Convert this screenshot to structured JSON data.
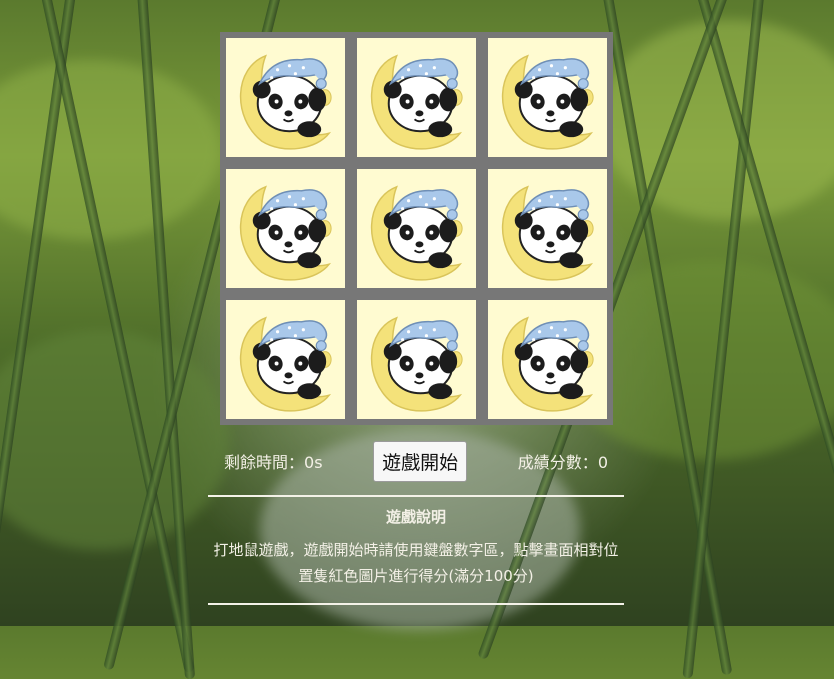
{
  "game": {
    "title": "遊戲說明",
    "timer_label": "剩餘時間：",
    "timer_value": "0s",
    "score_label": "成績分數：",
    "score_value": "0",
    "start_button": "遊戲開始",
    "instructions": "打地鼠遊戲，遊戲開始時請使用鍵盤數字區，點擊畫面相對位置隻紅色圖片進行得分(滿分100分)"
  },
  "board": {
    "cells": [
      {
        "icon": "panda-moon-icon"
      },
      {
        "icon": "panda-moon-icon"
      },
      {
        "icon": "panda-moon-icon"
      },
      {
        "icon": "panda-moon-icon"
      },
      {
        "icon": "panda-moon-icon"
      },
      {
        "icon": "panda-moon-icon"
      },
      {
        "icon": "panda-moon-icon"
      },
      {
        "icon": "panda-moon-icon"
      },
      {
        "icon": "panda-moon-icon"
      }
    ]
  },
  "colors": {
    "cell_background": "#fffbd1",
    "board_frame": "#777777",
    "moon": "#f4e27a",
    "nightcap": "#a9c8ea"
  }
}
